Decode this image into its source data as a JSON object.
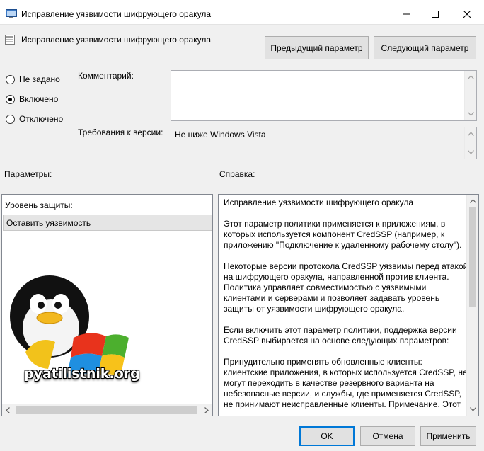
{
  "window": {
    "title": "Исправление уязвимости шифрующего оракула"
  },
  "header": {
    "setting_name": "Исправление уязвимости шифрующего оракула",
    "prev_button": "Предыдущий параметр",
    "next_button": "Следующий параметр"
  },
  "state": {
    "options": [
      "Не задано",
      "Включено",
      "Отключено"
    ],
    "selected": "Включено"
  },
  "comment": {
    "label": "Комментарий:",
    "value": ""
  },
  "supported": {
    "label": "Требования к версии:",
    "value": "Не ниже Windows Vista"
  },
  "options_section": {
    "label": "Параметры:",
    "protection_label": "Уровень защиты:",
    "protection_value": "Оставить уязвимость"
  },
  "help_section": {
    "label": "Справка:",
    "paragraphs": [
      "Исправление уязвимости шифрующего оракула",
      "Этот параметр политики применяется к приложениям, в которых используется компонент CredSSP (например, к приложению \"Подключение к удаленному рабочему столу\").",
      "Некоторые версии протокола CredSSP уязвимы перед атакой на шифрующего оракула, направленной против клиента. Политика управляет совместимостью с уязвимыми клиентами и серверами и позволяет задавать уровень защиты от уязвимости шифрующего оракула.",
      "Если включить этот параметр политики, поддержка версии CredSSP выбирается на основе следующих параметров:",
      "Принудительно применять обновленные клиенты: клиентские приложения, в которых используется CredSSP, не могут переходить в качестве резервного варианта на небезопасные версии, и службы, где применяется CredSSP, не принимают неисправленные клиенты. Примечание. Этот"
    ]
  },
  "watermark": {
    "text": "pyatilistnik.org"
  },
  "footer": {
    "ok": "OK",
    "cancel": "Отмена",
    "apply": "Применить"
  },
  "colors": {
    "accent": "#0078d7",
    "window_bg": "#f0f0f0",
    "selection": "#e5e5e5"
  }
}
